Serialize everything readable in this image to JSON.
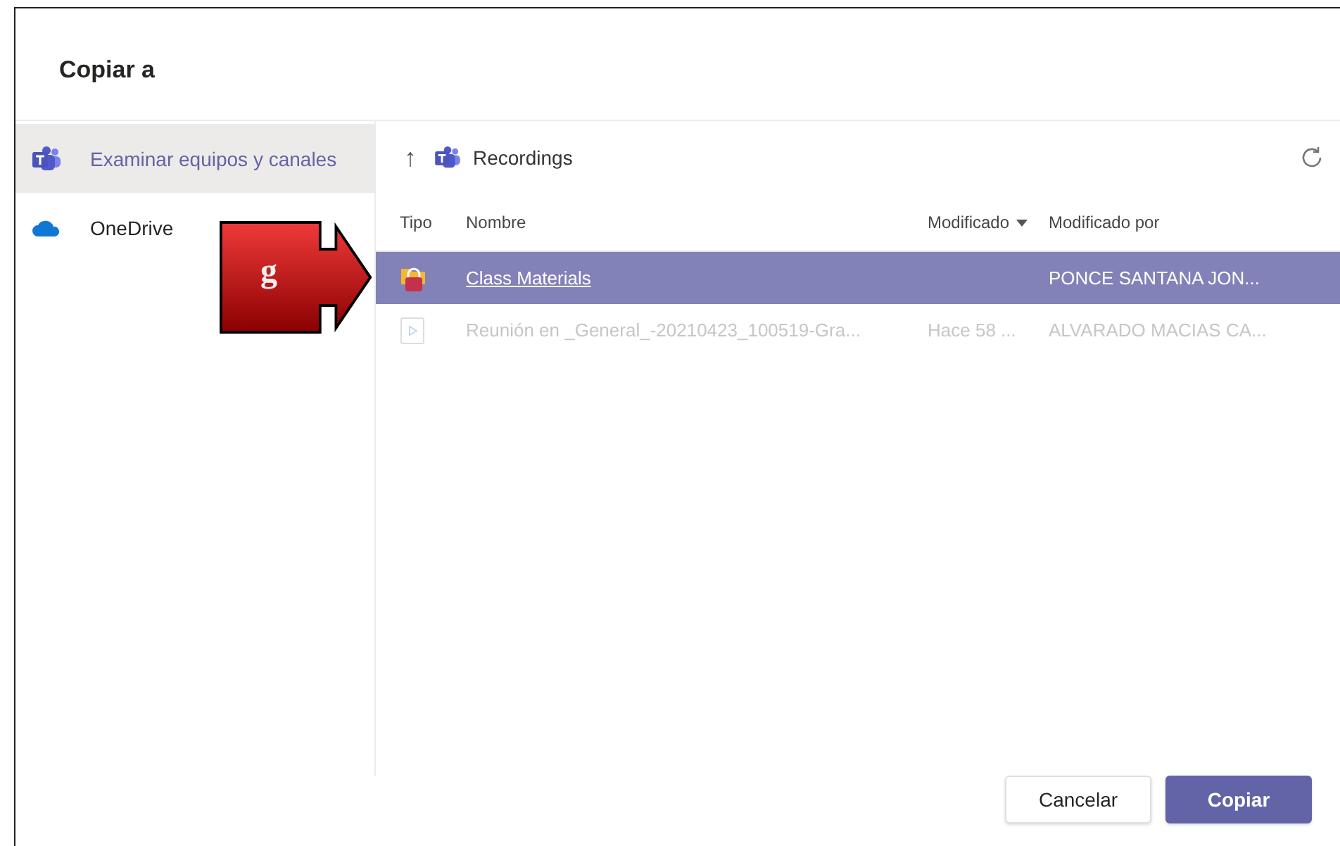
{
  "dialog": {
    "title": "Copiar a"
  },
  "sidebar": {
    "items": [
      {
        "label": "Examinar equipos y canales",
        "kind": "teams",
        "selected": true
      },
      {
        "label": "OneDrive",
        "kind": "onedrive",
        "selected": false
      }
    ]
  },
  "breadcrumb": {
    "up": "↑",
    "location": "Recordings"
  },
  "table": {
    "columns": [
      {
        "label": "Tipo",
        "sorted": false
      },
      {
        "label": "Nombre",
        "sorted": false
      },
      {
        "label": "Modificado",
        "sorted": true
      },
      {
        "label": "Modificado por",
        "sorted": false
      }
    ],
    "rows": [
      {
        "kind": "folder",
        "name": "Class Materials",
        "modified": "",
        "modified_by": "PONCE SANTANA JON...",
        "selected": true,
        "disabled": false
      },
      {
        "kind": "video",
        "name": "Reunión en _General_-20210423_100519-Gra...",
        "modified": "Hace 58 ...",
        "modified_by": "ALVARADO MACIAS CA...",
        "selected": false,
        "disabled": true
      }
    ]
  },
  "buttons": [
    {
      "label": "Cancelar",
      "kind": "secondary"
    },
    {
      "label": "Copiar",
      "kind": "primary"
    }
  ],
  "callout": {
    "label": "g"
  }
}
